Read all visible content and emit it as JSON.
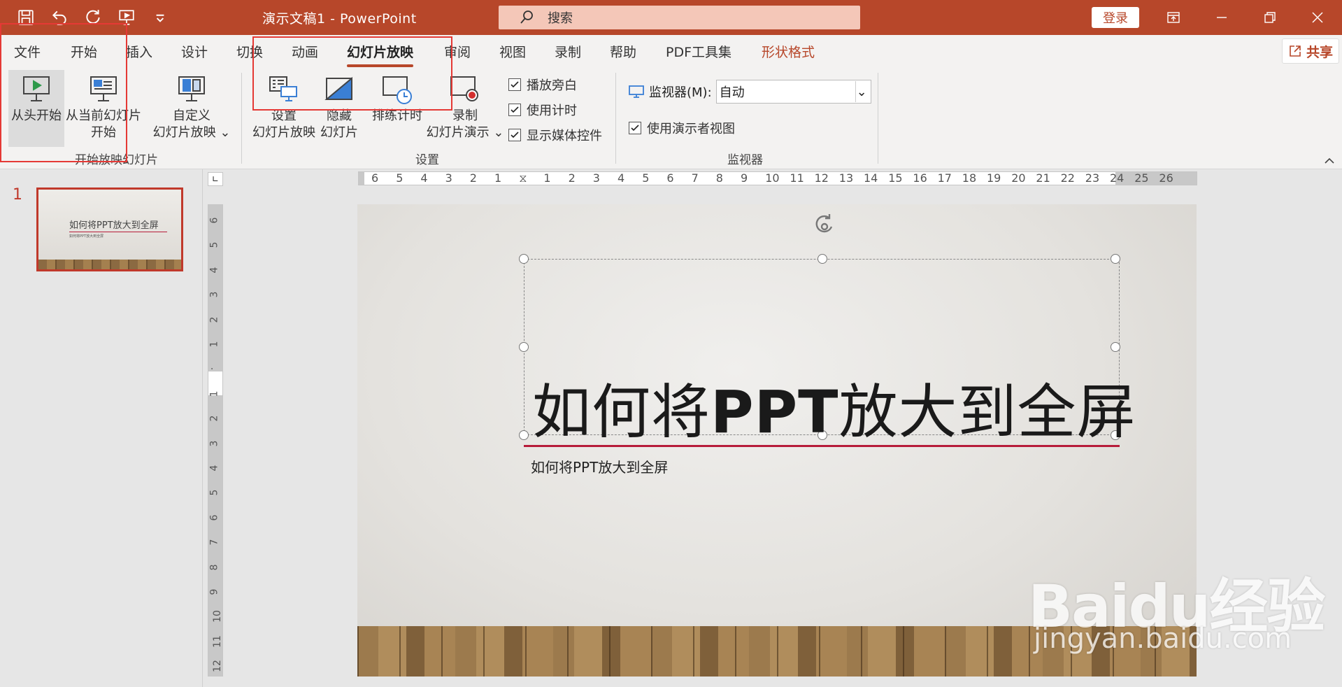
{
  "titlebar": {
    "doc_title": "演示文稿1  -  PowerPoint",
    "search_placeholder": "搜索",
    "login_label": "登录"
  },
  "tabs": [
    {
      "label": "文件"
    },
    {
      "label": "开始"
    },
    {
      "label": "插入"
    },
    {
      "label": "设计"
    },
    {
      "label": "切换"
    },
    {
      "label": "动画"
    },
    {
      "label": "幻灯片放映"
    },
    {
      "label": "审阅"
    },
    {
      "label": "视图"
    },
    {
      "label": "录制"
    },
    {
      "label": "帮助"
    },
    {
      "label": "PDF工具集"
    },
    {
      "label": "形状格式"
    }
  ],
  "share_label": "共享",
  "ribbon": {
    "start_group": {
      "label": "开始放映幻灯片",
      "from_beginning": "从头开始",
      "from_current_1": "从当前幻灯片",
      "from_current_2": "开始",
      "custom_1": "自定义",
      "custom_2": "幻灯片放映"
    },
    "setup_group": {
      "label": "设置",
      "setup_1": "设置",
      "setup_2": "幻灯片放映",
      "hide_1": "隐藏",
      "hide_2": "幻灯片",
      "rehearse": "排练计时",
      "record_1": "录制",
      "record_2": "幻灯片演示",
      "play_narration": "播放旁白",
      "use_timings": "使用计时",
      "show_media_controls": "显示媒体控件"
    },
    "monitor_group": {
      "label": "监视器",
      "monitor_label": "监视器(M):",
      "monitor_value": "自动",
      "presenter_view": "使用演示者视图"
    }
  },
  "slides_pane": {
    "slide_number": "1",
    "thumb_title": "如何将PPT放大到全屏",
    "thumb_sub": "如何将PPT放大到全屏"
  },
  "rulers": {
    "horizontal": [
      "6",
      "5",
      "4",
      "3",
      "2",
      "1",
      "0",
      "1",
      "2",
      "3",
      "4",
      "5",
      "6",
      "7",
      "8",
      "9",
      "10",
      "11",
      "12",
      "13",
      "14",
      "15",
      "16",
      "17",
      "18",
      "19",
      "20",
      "21",
      "22",
      "23",
      "24",
      "25",
      "26"
    ],
    "vertical": [
      "6",
      "5",
      "4",
      "3",
      "2",
      "1",
      "0",
      "1",
      "2",
      "3",
      "4",
      "5",
      "6",
      "7",
      "8",
      "9",
      "10",
      "11",
      "12"
    ]
  },
  "slide": {
    "title_part1": "如何将",
    "title_bold": "PPT",
    "title_part2": "放大到全屏",
    "subtitle": "如何将PPT放大到全屏"
  },
  "watermark": {
    "brand": "Baidu经验",
    "url": "jingyan.baidu.com"
  }
}
